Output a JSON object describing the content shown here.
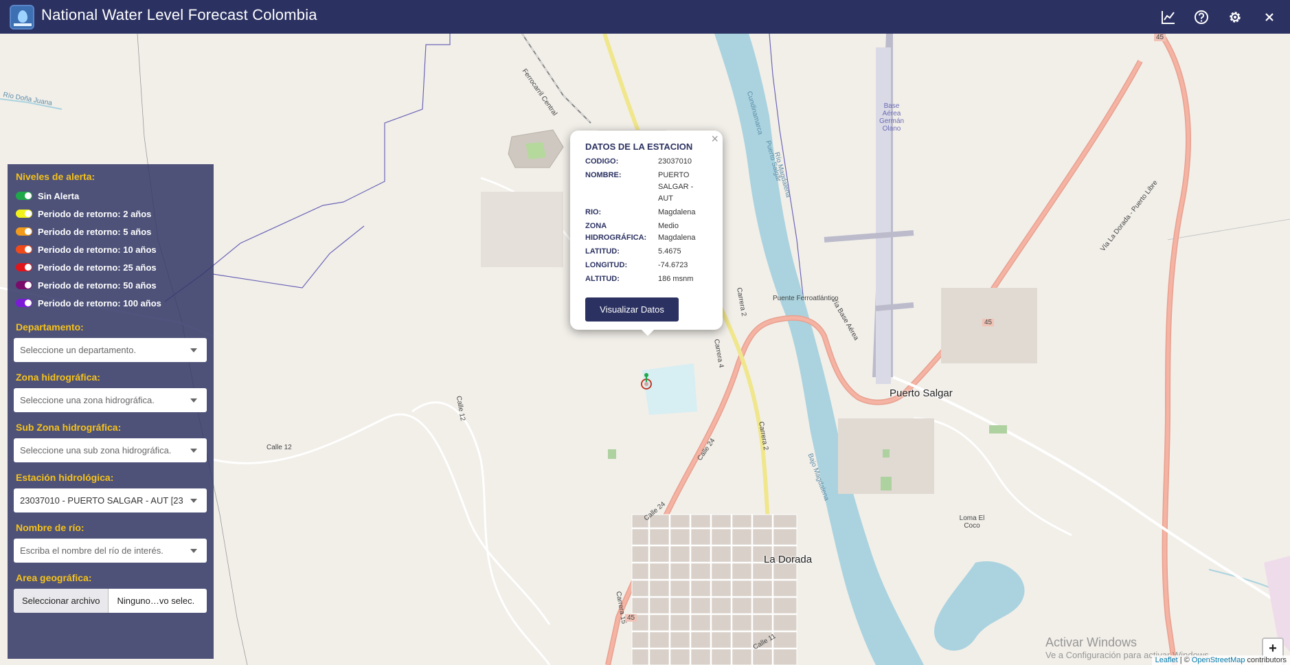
{
  "header": {
    "title": "National Water Level Forecast Colombia",
    "icons": [
      "chart-icon",
      "help-icon",
      "settings-icon",
      "close-icon"
    ]
  },
  "panel": {
    "legend_title": "Niveles de alerta:",
    "legend": [
      {
        "label": "Sin Alerta",
        "color": "#1ea84a"
      },
      {
        "label": "Periodo de retorno: 2 años",
        "color": "#f2f21b"
      },
      {
        "label": "Periodo de retorno: 5 años",
        "color": "#f29a1b"
      },
      {
        "label": "Periodo de retorno: 10 años",
        "color": "#f04a1b"
      },
      {
        "label": "Periodo de retorno: 25 años",
        "color": "#e0141b"
      },
      {
        "label": "Periodo de retorno: 50 años",
        "color": "#7a0d6b"
      },
      {
        "label": "Periodo de retorno: 100 años",
        "color": "#7b1bd8"
      }
    ],
    "departamento": {
      "label": "Departamento:",
      "placeholder": "Seleccione un departamento."
    },
    "zona": {
      "label": "Zona hidrográfica:",
      "placeholder": "Seleccione una zona hidrográfica."
    },
    "subzona": {
      "label": "Sub Zona hidrográfica:",
      "placeholder": "Seleccione una sub zona hidrográfica."
    },
    "estacion": {
      "label": "Estación hidrológica:",
      "value": "23037010 - PUERTO SALGAR - AUT [23"
    },
    "rio": {
      "label": "Nombre de río:",
      "placeholder": "Escriba el nombre del río de interés."
    },
    "area": {
      "label": "Area geográfica:",
      "button": "Seleccionar archivo",
      "file": "Ninguno…vo selec."
    }
  },
  "popup": {
    "title": "DATOS DE LA ESTACION",
    "rows": [
      {
        "k": "CODIGO:",
        "v": "23037010"
      },
      {
        "k": "NOMBRE:",
        "v": "PUERTO SALGAR - AUT"
      },
      {
        "k": "RIO:",
        "v": "Magdalena"
      },
      {
        "k": "ZONA HIDROGRÁFICA:",
        "v": "Medio Magdalena"
      },
      {
        "k": "LATITUD:",
        "v": "5.4675"
      },
      {
        "k": "LONGITUD:",
        "v": "-74.6723"
      },
      {
        "k": "ALTITUD:",
        "v": "186 msnm"
      }
    ],
    "button": "Visualizar Datos",
    "close": "×"
  },
  "map": {
    "towns": {
      "puerto_salgar": "Puerto Salgar",
      "la_dorada": "La Dorada"
    },
    "labels": {
      "rio_dona_juana": "Río Doña Juana",
      "ferrocarril": "Ferrocarril Central",
      "cundinamarca": "Cundinamarca",
      "puerto_salgar_lbl": "Puerto Salgar",
      "rio_magdalena": "Río Magdalena",
      "bajo_magdalena": "Bajo Magdalena",
      "base_aerea": "Base Aérea Germán Olano",
      "puente": "Puente Ferroatlántico",
      "via_dorada": "Vía La Dorada - Puerto Libre",
      "via_base": "Vía Base Aérea",
      "loma": "Loma El Coco",
      "calle12": "Calle 12",
      "calle24": "Calle 24",
      "carrera2": "Carrera 2",
      "carrera4": "Carrera 4",
      "carrera15": "Carrera 15",
      "calle11": "Calle 11",
      "route45": "45"
    },
    "zoom_in": "+",
    "zoom_out": "−"
  },
  "attribution": {
    "leaflet": "Leaflet",
    "sep": " | © ",
    "osm": "OpenStreetMap",
    "suffix": " contributors"
  },
  "watermark": {
    "line1": "Activar Windows",
    "line2": "Ve a Configuración para activar Windows."
  }
}
